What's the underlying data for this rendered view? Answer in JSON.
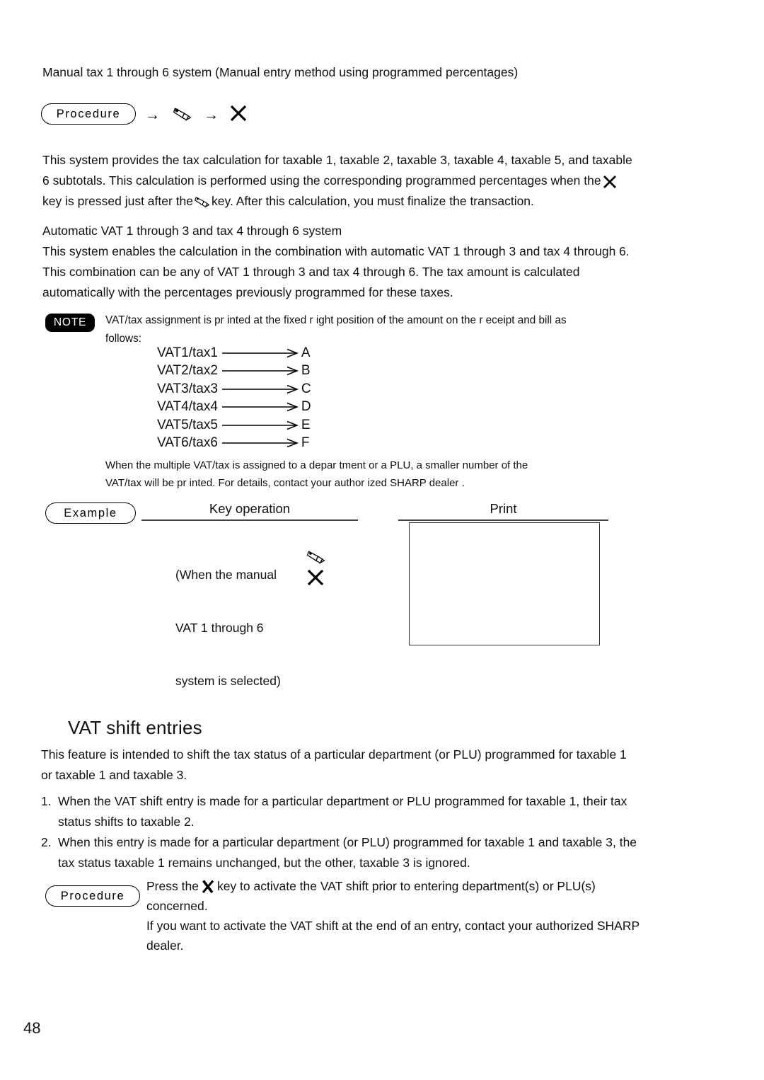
{
  "page": {
    "number": "48"
  },
  "intro": {
    "heading": "Manual tax 1 through 6 system (Manual entry method using programmed percentages)"
  },
  "procedure_top": {
    "label": "Procedure",
    "arrow1": "→",
    "icon1": "subtotal-key-icon",
    "arrow2": "→",
    "icon2": "x-key-icon"
  },
  "manual_tax_paragraph": {
    "line1": "This system provides the tax calculation for taxable 1, taxable 2, taxable 3, taxable 4, taxable 5, and taxable",
    "line2_a": "6 subtotals. This calculation is performed using the corresponding programmed percentages when the",
    "line2_icon": "x-key-icon",
    "line3_a": "key is pressed just after the",
    "line3_icon": "subtotal-key-icon",
    "line3_b": "key. After this calculation, you must finalize the transaction."
  },
  "auto_vat": {
    "heading": "Automatic VAT 1 through 3 and tax 4 through 6 system",
    "line1": "This system enables the calculation in the combination with automatic VAT 1 through 3 and tax 4 through 6.",
    "line2": "This combination can be any of VAT 1 through 3 and tax 4 through 6. The tax amount is calculated",
    "line3": "automatically with the percentages previously programmed for these taxes."
  },
  "note": {
    "badge": "NOTE",
    "line1": "VAT/tax assignment is pr inted at the fixed r ight position of the amount on the r eceipt and bill as",
    "line2": "follows:",
    "mapping": [
      {
        "source": "VAT1/tax1",
        "target": "A"
      },
      {
        "source": "VAT2/tax2",
        "target": "B"
      },
      {
        "source": "VAT3/tax3",
        "target": "C"
      },
      {
        "source": "VAT4/tax4",
        "target": "D"
      },
      {
        "source": "VAT5/tax5",
        "target": "E"
      },
      {
        "source": "VAT6/tax6",
        "target": "F"
      }
    ],
    "footer_line1": "When the multiple VAT/tax is assigned to a depar tment or  a PLU, a smaller  number  of the",
    "footer_line2": "VAT/tax will be pr inted. For  details, contact your  author ized SHARP dealer ."
  },
  "example": {
    "label": "Example",
    "key_operation_title": "Key operation",
    "print_title": "Print",
    "caption_line1": "(When the manual",
    "caption_line2": "VAT 1 through 6",
    "caption_line3": "system is selected)",
    "key_icon1": "subtotal-key-icon",
    "key_icon2": "x-key-icon",
    "print_content": ""
  },
  "vat_shift": {
    "heading": "VAT shift entries",
    "intro_line1": "This feature is intended to shift the tax status of a particular department (or PLU) programmed for taxable 1",
    "intro_line2": "or taxable 1 and taxable 3.",
    "items": [
      {
        "marker": "1.",
        "line1": "When the VAT shift entry is made for a particular department or PLU programmed for taxable 1, their tax",
        "line2": "status shifts to taxable 2."
      },
      {
        "marker": "2.",
        "line1": "When this entry is made for a particular department (or PLU) programmed for taxable 1 and taxable 3, the",
        "line2": "tax status  taxable 1  remains unchanged, but the other,  taxable 3  is ignored."
      }
    ]
  },
  "procedure_bottom": {
    "label": "Procedure",
    "line1_a": "Press the",
    "line1_icon": "vat-shift-key-icon",
    "line1_b": "key to activate the VAT shift prior to entering department(s) or PLU(s)",
    "line2": "concerned.",
    "line3": "If you want to activate the VAT shift at the end of an entry, contact your authorized SHARP",
    "line4": "dealer."
  }
}
